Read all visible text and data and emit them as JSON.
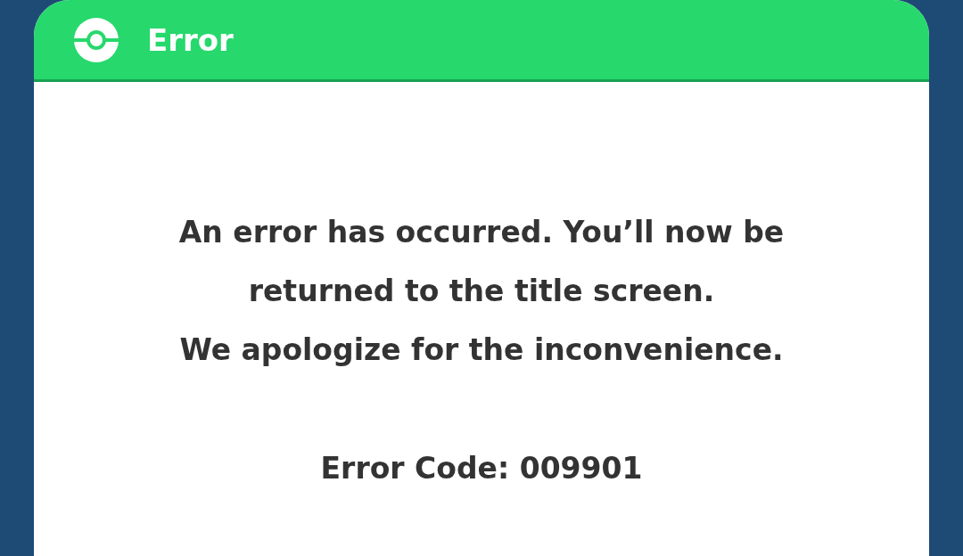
{
  "dialog": {
    "title": "Error",
    "message_lines": [
      "An error has occurred. You’ll now be",
      "returned to the title screen.",
      "We apologize for the inconvenience."
    ],
    "error_code": "Error Code: 009901"
  }
}
